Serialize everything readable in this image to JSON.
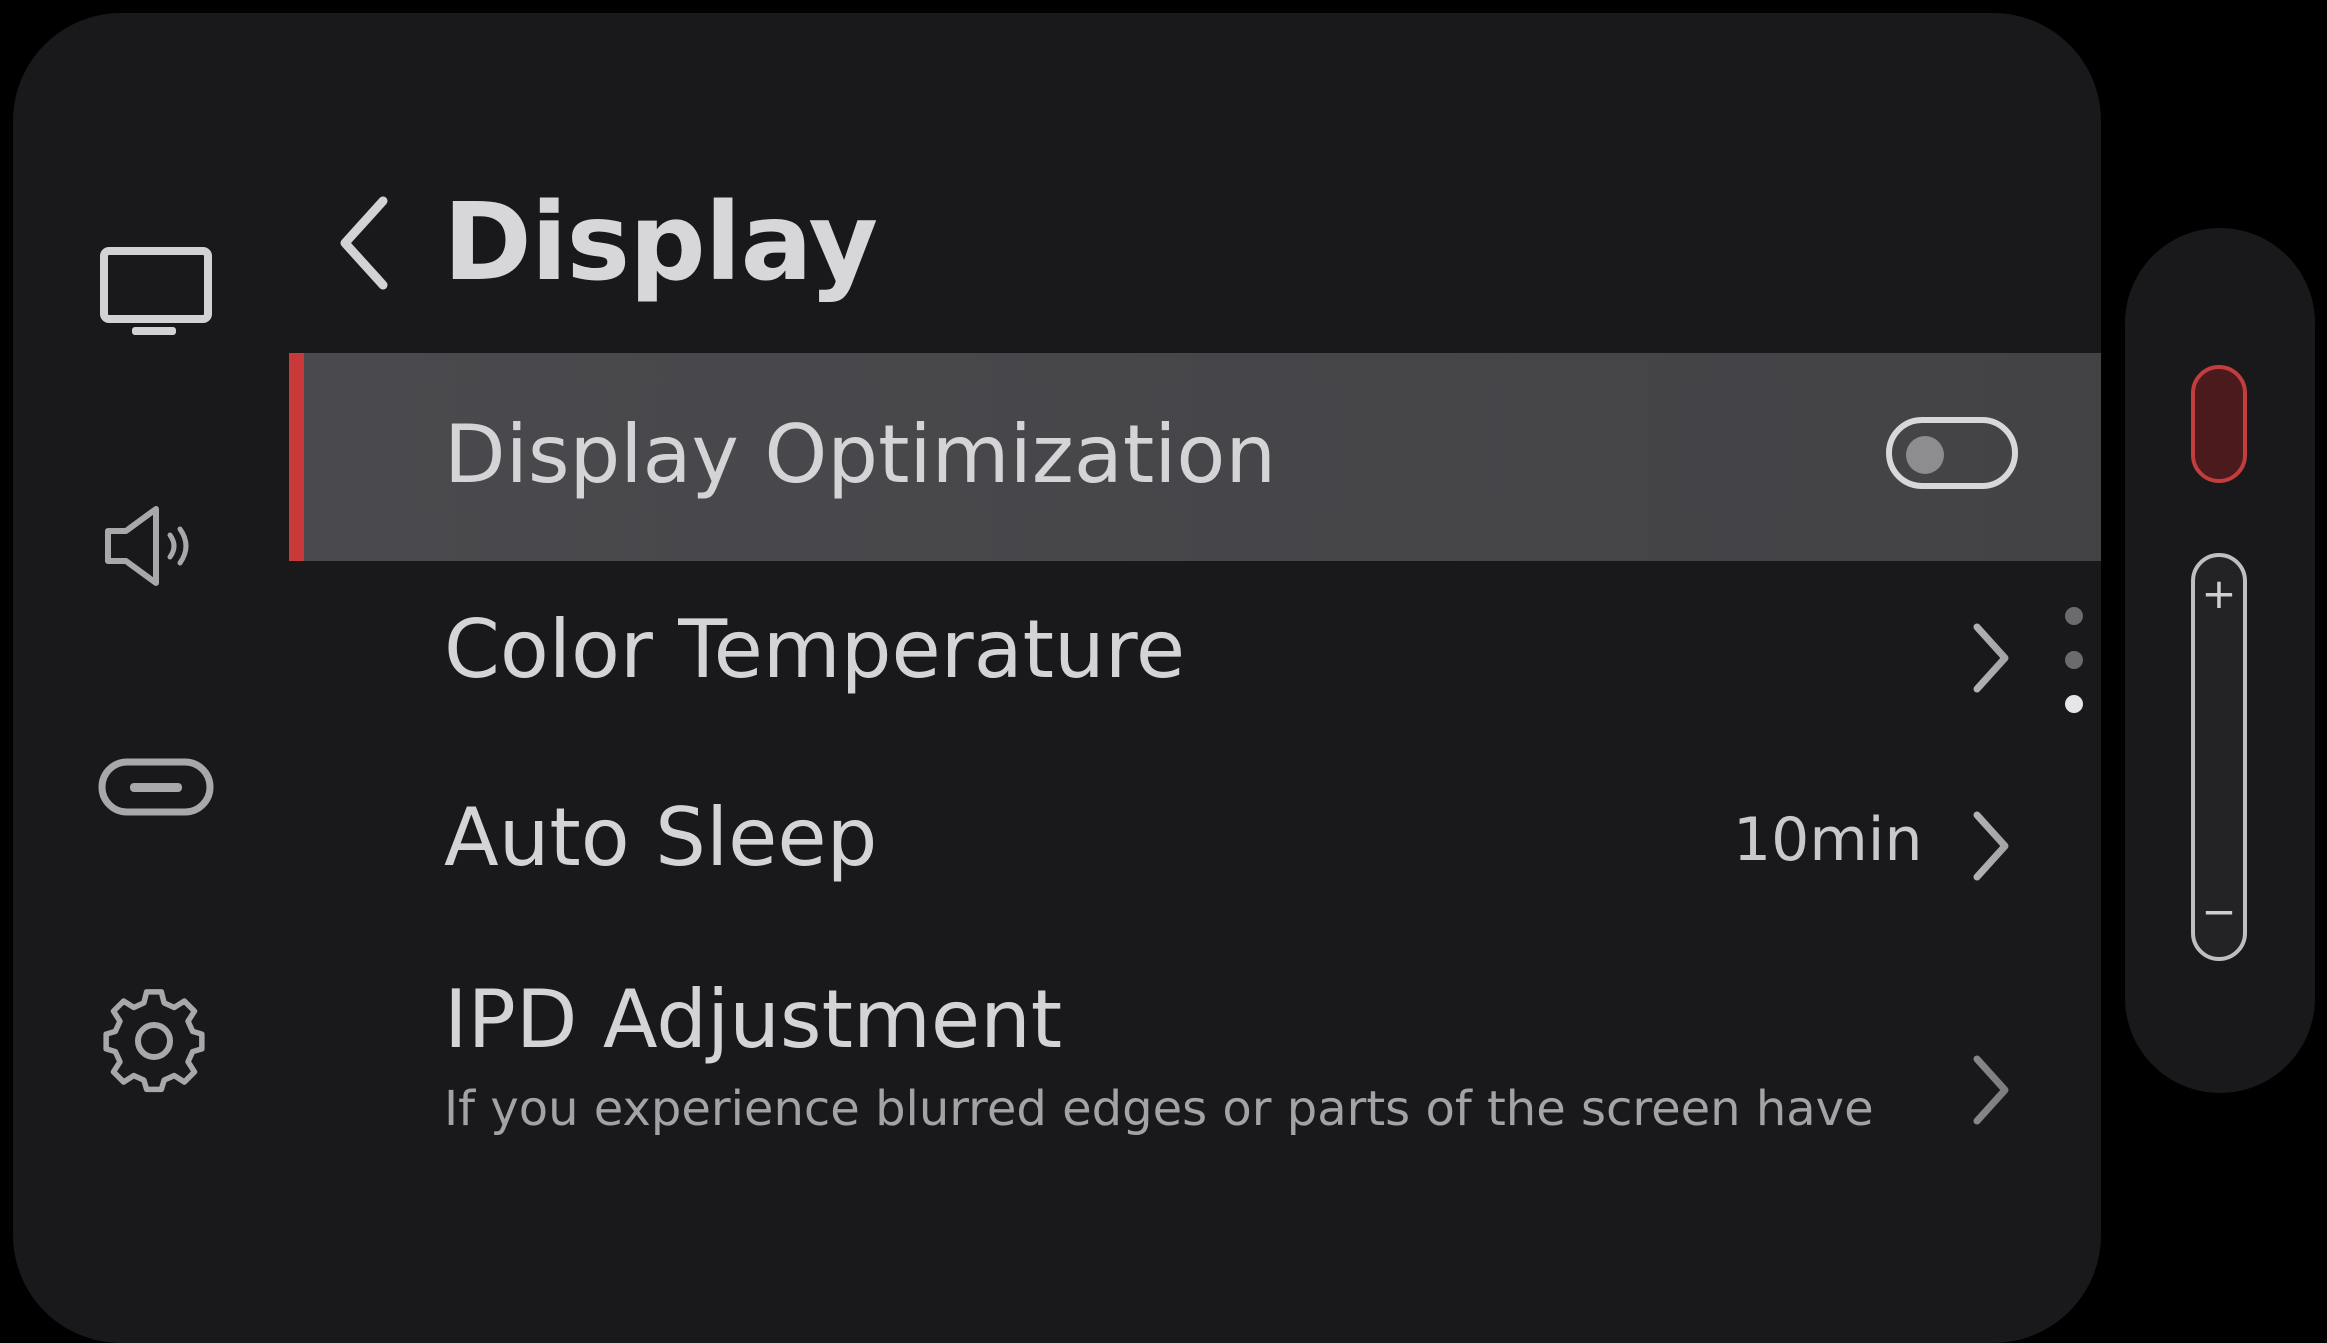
{
  "header": {
    "back_icon": "chevron-left-icon",
    "title": "Display"
  },
  "sidebar": {
    "items": [
      {
        "icon": "monitor-icon",
        "active": true
      },
      {
        "icon": "speaker-icon",
        "active": false
      },
      {
        "icon": "pill-button-icon",
        "active": false
      },
      {
        "icon": "gear-icon",
        "active": false
      }
    ]
  },
  "settings": {
    "display_optimization": {
      "label": "Display Optimization",
      "toggle_on": false
    },
    "color_temperature": {
      "label": "Color Temperature"
    },
    "auto_sleep": {
      "label": "Auto Sleep",
      "value": "10min"
    },
    "ipd_adjustment": {
      "label": "IPD Adjustment",
      "description": "If you experience blurred edges or parts of the screen have"
    }
  },
  "volume": {
    "plus": "+",
    "minus": "−"
  },
  "colors": {
    "accent": "#c9393a",
    "background": "#19191c",
    "selected_row": "#48484b",
    "text": "#d4d4d6"
  }
}
